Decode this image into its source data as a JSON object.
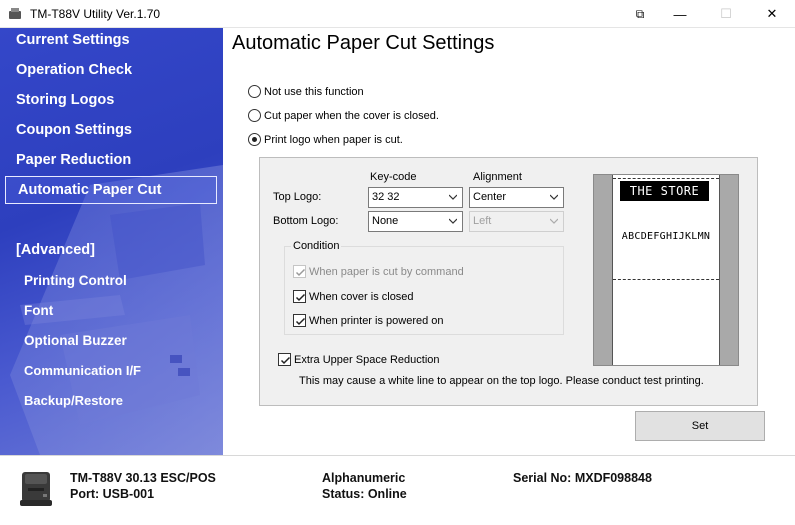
{
  "window": {
    "title": "TM-T88V Utility Ver.1.70",
    "buttons": {
      "extra": "⧉",
      "minimize": "—",
      "maximize": "☐",
      "close": "✕"
    }
  },
  "sidebar": {
    "items": [
      {
        "label": "Current Settings"
      },
      {
        "label": "Operation Check"
      },
      {
        "label": "Storing Logos"
      },
      {
        "label": "Coupon Settings"
      },
      {
        "label": "Paper Reduction"
      },
      {
        "label": "Automatic Paper Cut",
        "active": true
      }
    ],
    "advanced_header": "[Advanced]",
    "advanced_items": [
      {
        "label": "Printing Control"
      },
      {
        "label": "Font"
      },
      {
        "label": "Optional Buzzer"
      },
      {
        "label": "Communication I/F"
      },
      {
        "label": "Backup/Restore"
      }
    ]
  },
  "main": {
    "title": "Automatic Paper Cut Settings",
    "options": [
      {
        "label": "Not use this function",
        "selected": false
      },
      {
        "label": "Cut paper when the cover is closed.",
        "selected": false
      },
      {
        "label": "Print logo when paper is cut.",
        "selected": true
      }
    ],
    "logo_settings": {
      "keycode_header": "Key-code",
      "alignment_header": "Alignment",
      "top_logo_label": "Top Logo:",
      "top_logo_keycode": "32  32",
      "top_logo_alignment": "Center",
      "bottom_logo_label": "Bottom Logo:",
      "bottom_logo_keycode": "None",
      "bottom_logo_alignment": "Left"
    },
    "condition": {
      "title": "Condition",
      "items": [
        {
          "label": "When paper is cut by command",
          "checked": true,
          "disabled": true
        },
        {
          "label": "When cover is closed",
          "checked": true,
          "disabled": false
        },
        {
          "label": "When printer is powered on",
          "checked": true,
          "disabled": false
        }
      ]
    },
    "preview": {
      "logo_text": "THE STORE",
      "body_text": "ABCDEFGHIJKLMN"
    },
    "extra_space": {
      "label": "Extra Upper Space Reduction",
      "checked": true,
      "note": "This may cause a white line to appear on the top logo. Please conduct test printing."
    },
    "set_label": "Set"
  },
  "footer": {
    "model": "TM-T88V 30.13 ESC/POS",
    "port": "Port: USB-001",
    "charset": "Alphanumeric",
    "status": "Status: Online",
    "serial": "Serial No: MXDF098848"
  }
}
